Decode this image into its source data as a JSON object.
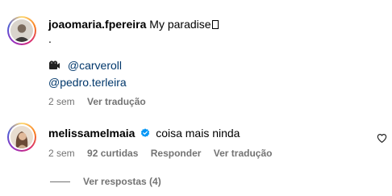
{
  "comments": [
    {
      "username": "joaomaria.fpereira",
      "text": "My paradise",
      "text_line2": ".",
      "camera_emoji": "camera-icon",
      "mention1": "@carveroll",
      "mention2": "@pedro.terleira",
      "time": "2 sem",
      "translate": "Ver tradução"
    },
    {
      "username": "melissamelmaia",
      "text": "coisa mais ninda",
      "time": "2 sem",
      "likes": "92 curtidas",
      "reply": "Responder",
      "translate": "Ver tradução",
      "view_replies": "Ver respostas (4)"
    }
  ],
  "colors": {
    "meta": "#737373",
    "mention": "#00376b",
    "verified": "#0095f6"
  }
}
